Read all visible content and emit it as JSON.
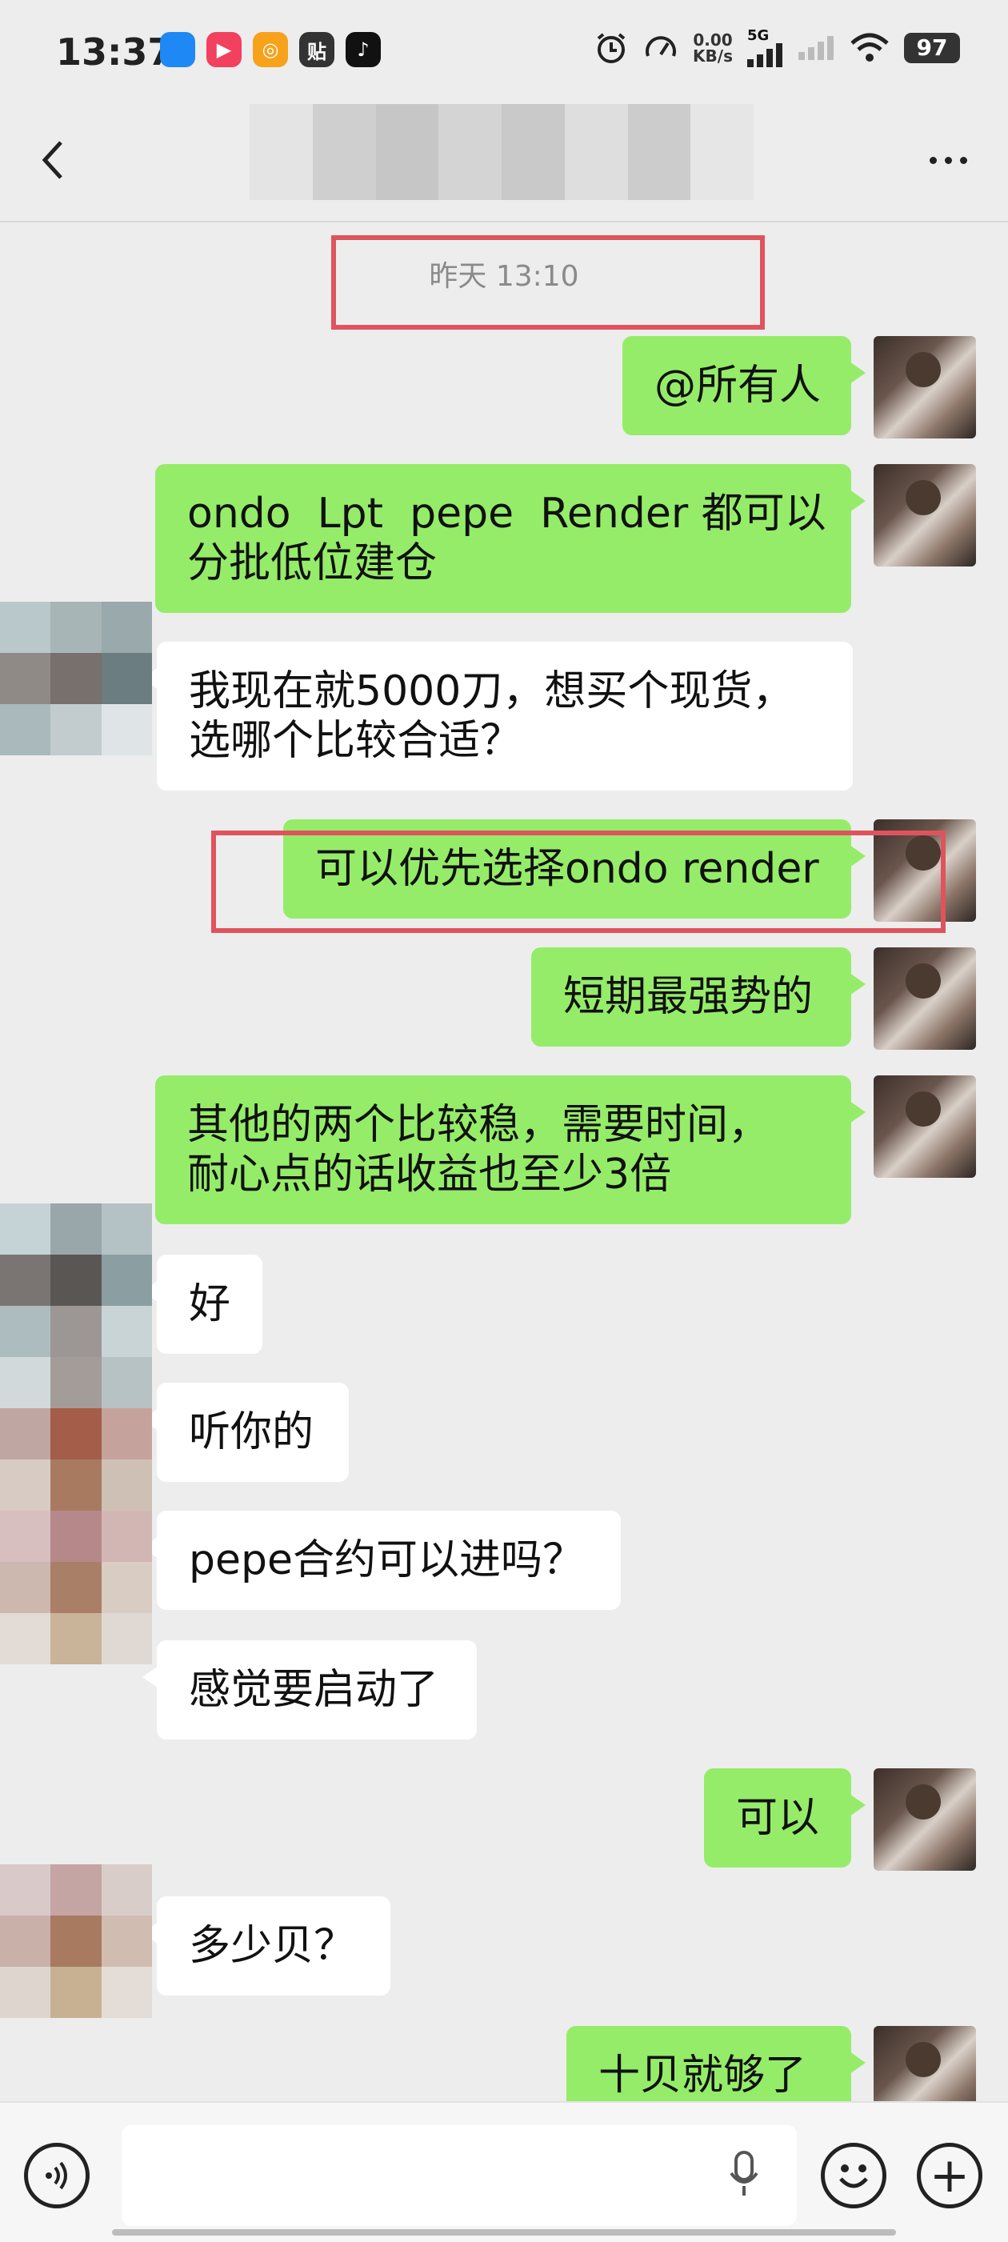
{
  "status_bar": {
    "time": "13:37",
    "net_speed_value": "0.00",
    "net_speed_unit": "KB/s",
    "network": "5G",
    "battery": "97",
    "app_icons": [
      {
        "name": "browser-app-icon",
        "glyph": "",
        "color": "#1e88f5"
      },
      {
        "name": "video-app-icon",
        "glyph": "▶",
        "color": "#f2415f"
      },
      {
        "name": "coin-app-icon",
        "glyph": "◎",
        "color": "#f7a21b"
      },
      {
        "name": "tieba-app-icon",
        "glyph": "贴",
        "color": "#333333"
      },
      {
        "name": "tiktok-app-icon",
        "glyph": "♪",
        "color": "#111111"
      }
    ]
  },
  "header": {
    "title_blur_colors": [
      "#e4e4e4",
      "#cfcfcf",
      "#c6c6c6",
      "#d4d4d4",
      "#c9c9c9",
      "#dedede",
      "#cccccc",
      "#e6e6e6"
    ]
  },
  "chat": {
    "timestamp": "昨天 13:10",
    "messages": [
      {
        "side": "out",
        "lines": [
          "@所有人"
        ]
      },
      {
        "side": "out",
        "lines": [
          "ondo  Lpt  pepe  Render 都可以",
          "分批低位建仓"
        ]
      },
      {
        "side": "in",
        "lines": [
          "我现在就5000刀，想买个现货，",
          "选哪个比较合适？"
        ]
      },
      {
        "side": "out",
        "lines": [
          "可以优先选择ondo render"
        ]
      },
      {
        "side": "out",
        "lines": [
          "短期最强势的"
        ]
      },
      {
        "side": "out",
        "lines": [
          "其他的两个比较稳，需要时间，",
          "耐心点的话收益也至少3倍"
        ]
      },
      {
        "side": "in",
        "lines": [
          "好"
        ]
      },
      {
        "side": "in",
        "lines": [
          "听你的"
        ]
      },
      {
        "side": "in",
        "lines": [
          "pepe合约可以进吗？"
        ]
      },
      {
        "side": "in",
        "lines": [
          "感觉要启动了"
        ]
      },
      {
        "side": "out",
        "lines": [
          "可以"
        ]
      },
      {
        "side": "in",
        "lines": [
          "多少贝？"
        ]
      },
      {
        "side": "out",
        "lines": [
          "十贝就够了"
        ]
      }
    ]
  },
  "colors": {
    "bubble_out": "#95ec69",
    "bubble_in": "#ffffff",
    "highlight": "#e0535e",
    "background": "#ededed"
  },
  "input_bar": {
    "voice_icon": "voice-mode-icon",
    "mic_icon": "microphone-icon",
    "emoji_icon": "emoji-icon",
    "plus_icon": "plus-icon"
  }
}
